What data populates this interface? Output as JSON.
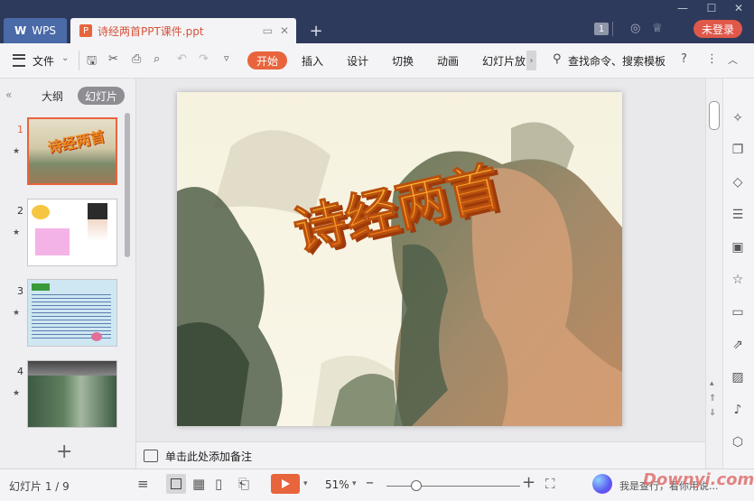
{
  "window": {
    "app_tab": "WPS",
    "doc_tab": "诗经两首PPT课件.ppt",
    "login": "未登录",
    "badge": "1"
  },
  "menu": {
    "file": "文件",
    "tabs": [
      "开始",
      "插入",
      "设计",
      "切换",
      "动画",
      "幻灯片放"
    ],
    "search": "查找命令、搜索模板"
  },
  "left_panel": {
    "tab_outline": "大纲",
    "tab_slides": "幻灯片",
    "thumbs": [
      {
        "num": "1"
      },
      {
        "num": "2"
      },
      {
        "num": "3"
      },
      {
        "num": "4"
      }
    ]
  },
  "slide": {
    "title": "诗经两首"
  },
  "notes": {
    "placeholder": "单击此处添加备注"
  },
  "status": {
    "slide_count": "幻灯片 1 / 9",
    "zoom": "51%",
    "assistant": "我是查行，看你用说..."
  },
  "watermark": "Downyi.com",
  "colors": {
    "accent": "#e8643c",
    "titlebar": "#2e3a5c"
  }
}
